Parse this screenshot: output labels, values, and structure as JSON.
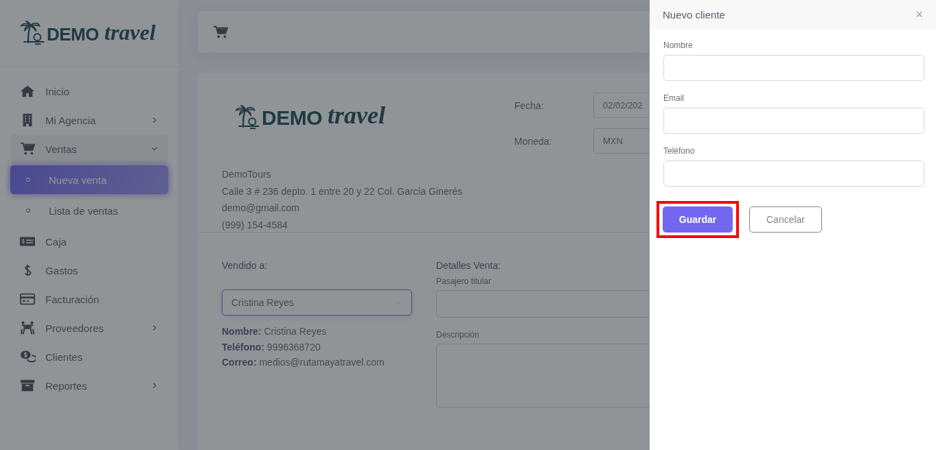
{
  "sidebar": {
    "logo": {
      "word1": "DEMO",
      "word2": "travel"
    },
    "items": [
      {
        "label": "Inicio"
      },
      {
        "label": "Mi Agencia",
        "expanded": false
      },
      {
        "label": "Ventas",
        "expanded": true,
        "children": [
          {
            "label": "Nueva venta",
            "selected": true
          },
          {
            "label": "Lista de ventas",
            "selected": false
          }
        ]
      },
      {
        "label": "Caja"
      },
      {
        "label": "Gastos"
      },
      {
        "label": "Facturación"
      },
      {
        "label": "Proveedores",
        "expanded": false
      },
      {
        "label": "Clientes"
      },
      {
        "label": "Reportes",
        "expanded": false
      }
    ]
  },
  "invoice": {
    "logo": {
      "word1": "DEMO",
      "word2": "travel"
    },
    "company_lines": [
      "DemoTours",
      "Calle 3 # 236 depto. 1 entre 20 y 22 Col. García Ginerés",
      "demo@gmail.com",
      "(999) 154-4584"
    ],
    "fields": [
      {
        "label": "Fecha:",
        "value": "02/02/202"
      },
      {
        "label": "Moneda:",
        "value": "MXN"
      }
    ],
    "sold_to": {
      "heading": "Vendido a:",
      "client": "Cristina Reyes",
      "info": [
        "**Nombre:** Cristina Reyes",
        "**Teléfono:** 9996368720",
        "**Correo:** medios@rutamayatravel.com"
      ]
    },
    "details": {
      "heading": "Detalles Venta:",
      "fields": [
        {
          "kind": "input",
          "label": "Pasajero titular"
        },
        {
          "kind": "textarea",
          "label": "Descripción"
        }
      ]
    }
  },
  "drawer": {
    "title": "Nuevo cliente",
    "close": "×",
    "fields": [
      {
        "label": "Nombre"
      },
      {
        "label": "Email"
      },
      {
        "label": "Teléfono"
      }
    ],
    "buttons": [
      {
        "label": "Guardar",
        "kind": "primary",
        "highlighted": true
      },
      {
        "label": "Cancelar",
        "kind": "outline",
        "highlighted": false
      }
    ]
  }
}
